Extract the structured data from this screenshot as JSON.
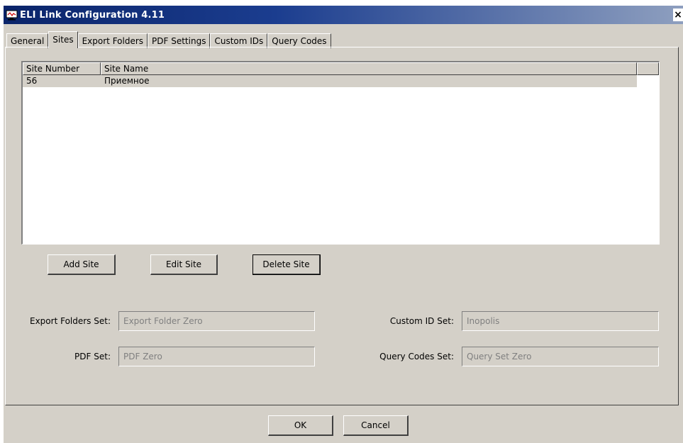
{
  "window": {
    "title": "ELI Link Configuration 4.11",
    "close_label": "×"
  },
  "tabs": [
    {
      "label": "General",
      "active": false
    },
    {
      "label": "Sites",
      "active": true
    },
    {
      "label": "Export Folders",
      "active": false
    },
    {
      "label": "PDF Settings",
      "active": false
    },
    {
      "label": "Custom IDs",
      "active": false
    },
    {
      "label": "Query Codes",
      "active": false
    }
  ],
  "sites_table": {
    "columns": [
      "Site Number",
      "Site Name"
    ],
    "rows": [
      {
        "number": "56",
        "name": "Приемное"
      }
    ]
  },
  "buttons": {
    "add_site": "Add Site",
    "edit_site": "Edit Site",
    "delete_site": "Delete Site",
    "ok": "OK",
    "cancel": "Cancel"
  },
  "fields": {
    "export_folders_set": {
      "label": "Export Folders Set:",
      "value": "Export Folder Zero"
    },
    "pdf_set": {
      "label": "PDF Set:",
      "value": "PDF Zero"
    },
    "custom_id_set": {
      "label": "Custom ID Set:",
      "value": "Inopolis"
    },
    "query_codes_set": {
      "label": "Query Codes Set:",
      "value": "Query Set Zero"
    }
  },
  "icons": {
    "app": "monitor-icon"
  }
}
